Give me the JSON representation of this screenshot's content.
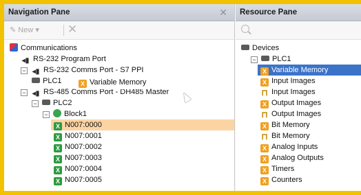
{
  "nav": {
    "title": "Navigation Pane",
    "toolbar": {
      "new_label": "New ▾"
    },
    "tree": [
      {
        "label": "Communications",
        "icon": "communications-icon",
        "indent": 0
      },
      {
        "label": "RS-232 Program Port",
        "icon": "port-icon",
        "indent": 1
      },
      {
        "label": "RS-232 Comms Port - S7 PPI",
        "icon": "port-icon",
        "indent": 1,
        "expander": "−"
      },
      {
        "label": "PLC1",
        "icon": "plc-icon",
        "indent": 2
      },
      {
        "label": "RS-485 Comms Port - DH485 Master",
        "icon": "port-icon",
        "indent": 1,
        "expander": "−"
      },
      {
        "label": "PLC2",
        "icon": "plc-icon",
        "indent": 2,
        "expander": "−"
      },
      {
        "label": "Block1",
        "icon": "block-icon",
        "indent": 3,
        "expander": "−"
      },
      {
        "label": "N007:0000",
        "icon": "tag-icon",
        "indent": 4,
        "selected": true
      },
      {
        "label": "N007:0001",
        "icon": "tag-icon",
        "indent": 4
      },
      {
        "label": "N007:0002",
        "icon": "tag-icon",
        "indent": 4
      },
      {
        "label": "N007:0003",
        "icon": "tag-icon",
        "indent": 4
      },
      {
        "label": "N007:0004",
        "icon": "tag-icon",
        "indent": 4
      },
      {
        "label": "N007:0005",
        "icon": "tag-icon",
        "indent": 4
      }
    ],
    "drag_tooltip": "Variable Memory"
  },
  "resource": {
    "title": "Resource Pane",
    "tree": [
      {
        "label": "Devices",
        "icon": "devices-icon",
        "indent": 0
      },
      {
        "label": "PLC1",
        "icon": "plc-icon",
        "indent": 1,
        "expander": "−"
      },
      {
        "label": "Variable Memory",
        "icon": "memory-icon",
        "indent": 2,
        "selected": true
      },
      {
        "label": "Input Images",
        "icon": "memory-icon",
        "indent": 2
      },
      {
        "label": "Input Images",
        "icon": "io-icon",
        "indent": 2
      },
      {
        "label": "Output Images",
        "icon": "memory-icon",
        "indent": 2
      },
      {
        "label": "Output Images",
        "icon": "io-icon",
        "indent": 2
      },
      {
        "label": "Bit Memory",
        "icon": "memory-icon",
        "indent": 2
      },
      {
        "label": "Bit Memory",
        "icon": "io-icon",
        "indent": 2
      },
      {
        "label": "Analog Inputs",
        "icon": "memory-icon",
        "indent": 2
      },
      {
        "label": "Analog Outputs",
        "icon": "memory-icon",
        "indent": 2
      },
      {
        "label": "Timers",
        "icon": "memory-icon",
        "indent": 2
      },
      {
        "label": "Counters",
        "icon": "memory-icon",
        "indent": 2
      }
    ]
  }
}
